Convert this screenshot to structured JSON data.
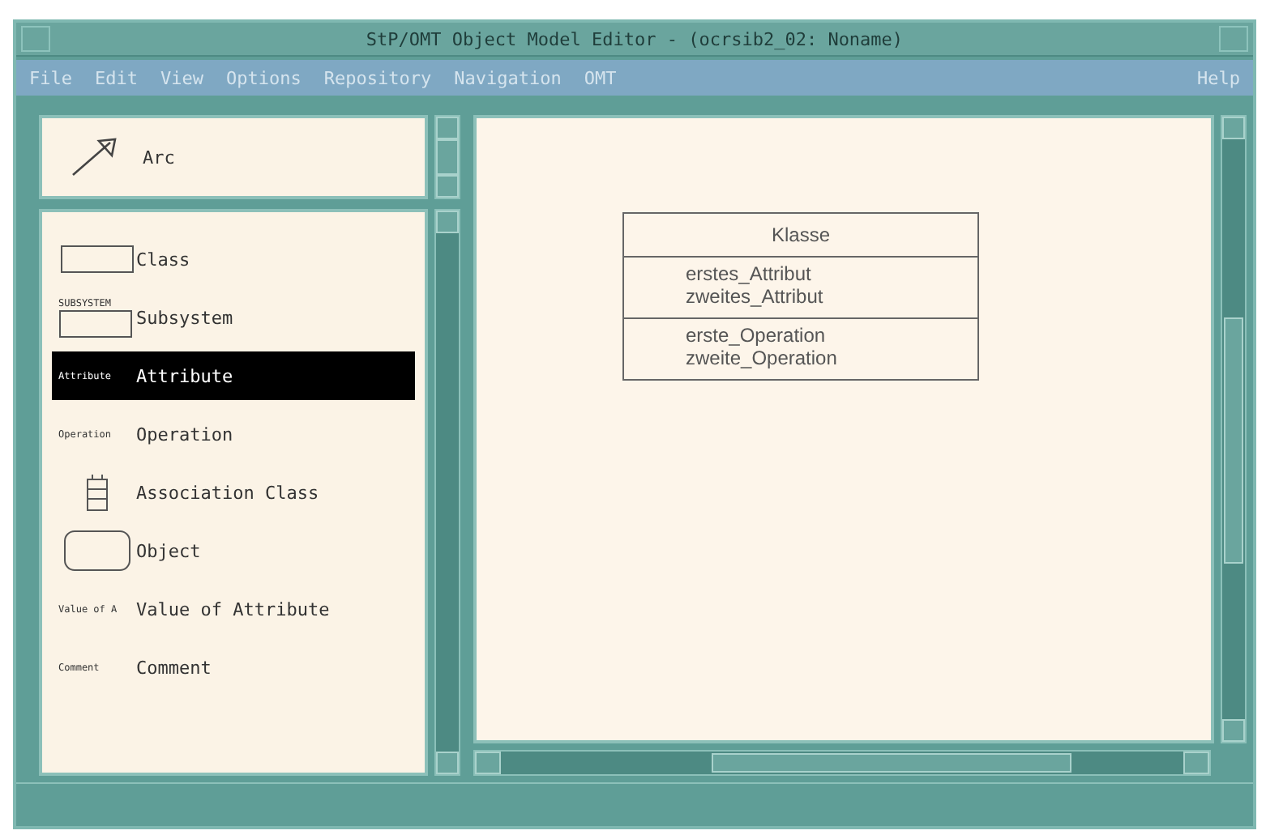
{
  "window": {
    "title": "StP/OMT Object Model Editor - (ocrsib2_02: Noname)"
  },
  "menu": [
    {
      "label": "File"
    },
    {
      "label": "Edit"
    },
    {
      "label": "View"
    },
    {
      "label": "Options"
    },
    {
      "label": "Repository"
    },
    {
      "label": "Navigation"
    },
    {
      "label": "OMT"
    }
  ],
  "help_menu": {
    "label": "Help"
  },
  "arc_tool": {
    "label": "Arc",
    "selected": false
  },
  "palette": [
    {
      "kind": "class",
      "label": "Class",
      "selected": false
    },
    {
      "kind": "subsystem",
      "label": "Subsystem",
      "caption": "SUBSYSTEM",
      "selected": false
    },
    {
      "kind": "caption",
      "label": "Attribute",
      "caption": "Attribute",
      "selected": true
    },
    {
      "kind": "caption",
      "label": "Operation",
      "caption": "Operation",
      "selected": false
    },
    {
      "kind": "association",
      "label": "Association Class",
      "selected": false
    },
    {
      "kind": "object",
      "label": "Object",
      "selected": false
    },
    {
      "kind": "caption",
      "label": "Value of Attribute",
      "caption": "Value of A",
      "selected": false
    },
    {
      "kind": "caption",
      "label": "Comment",
      "caption": "Comment",
      "selected": false
    }
  ],
  "diagram": {
    "class": {
      "name": "Klasse",
      "attributes": [
        "erstes_Attribut",
        "zweites_Attribut"
      ],
      "operations": [
        "erste_Operation",
        "zweite_Operation"
      ]
    }
  }
}
